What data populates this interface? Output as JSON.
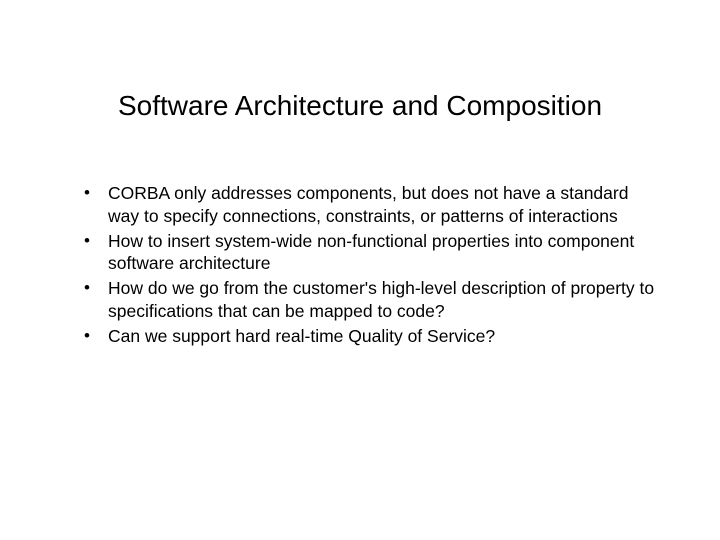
{
  "slide": {
    "title": "Software Architecture and Composition",
    "bullets": [
      "CORBA only addresses components, but does not have a standard way to specify connections, constraints, or patterns of interactions",
      "How to insert system-wide non-functional properties into component software architecture",
      "How do we go from the customer's high-level description of property to specifications that can be mapped to code?",
      "Can we support hard real-time Quality of Service?"
    ]
  }
}
